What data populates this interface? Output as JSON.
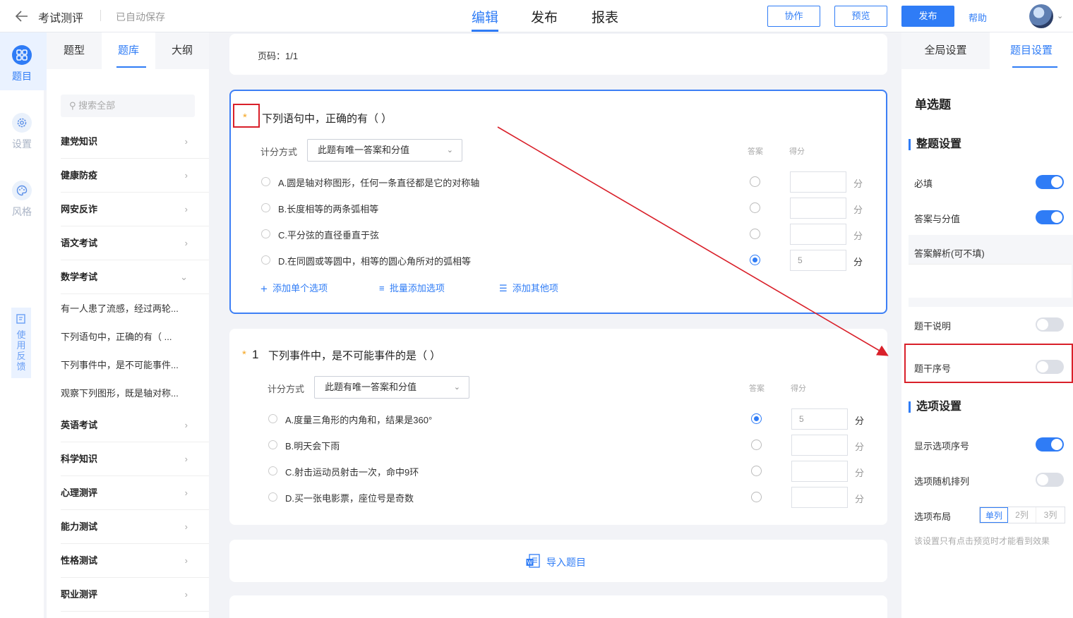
{
  "header": {
    "back_icon": "arrow-left-icon",
    "title": "考试测评",
    "autosave": "已自动保存",
    "tabs": [
      {
        "label": "编辑",
        "active": true
      },
      {
        "label": "发布",
        "active": false
      },
      {
        "label": "报表",
        "active": false
      }
    ],
    "collab_label": "协作",
    "preview_label": "预览",
    "publish_label": "发布",
    "help_label": "帮助"
  },
  "rail": [
    {
      "label": "题目",
      "icon": "grid-icon",
      "active": true
    },
    {
      "label": "设置",
      "icon": "gear-icon",
      "active": false
    },
    {
      "label": "风格",
      "icon": "palette-icon",
      "active": false
    }
  ],
  "feedback_label": "使用反馈",
  "bank": {
    "tabs": [
      "题型",
      "题库",
      "大纲"
    ],
    "active_tab": "题库",
    "search_placeholder": "搜索全部",
    "categories_top": [
      "建党知识",
      "健康防疫",
      "网安反诈",
      "语文考试",
      "数学考试"
    ],
    "expanded_items": [
      "有一人患了流感，经过两轮...",
      "下列语句中，正确的有（  ...",
      "下列事件中，是不可能事件...",
      "观察下列图形，既是轴对称..."
    ],
    "categories_bottom": [
      "英语考试",
      "科学知识",
      "心理测评",
      "能力测试",
      "性格测试",
      "职业测评"
    ]
  },
  "editor": {
    "page_label": "页码：1/1",
    "col_answer": "答案",
    "col_score": "得分",
    "scoring_label": "计分方式",
    "scoring_value": "此题有唯一答案和分值",
    "unit": "分",
    "q1": {
      "star": "*",
      "title": "下列语句中，正确的有（        ）",
      "options": [
        {
          "text": "A.圆是轴对称图形，任何一条直径都是它的对称轴",
          "correct": false,
          "score": ""
        },
        {
          "text": "B.长度相等的两条弧相等",
          "correct": false,
          "score": ""
        },
        {
          "text": "C.平分弦的直径垂直于弦",
          "correct": false,
          "score": ""
        },
        {
          "text": "D.在同圆或等圆中，相等的圆心角所对的弧相等",
          "correct": true,
          "score": "5"
        }
      ]
    },
    "add_single": "添加单个选项",
    "add_batch": "批量添加选项",
    "add_other": "添加其他项",
    "q2": {
      "star": "*",
      "number": "1",
      "title": "下列事件中，是不可能事件的是（        ）",
      "options": [
        {
          "text": "A.度量三角形的内角和，结果是360°",
          "correct": true,
          "score": "5"
        },
        {
          "text": "B.明天会下雨",
          "correct": false,
          "score": ""
        },
        {
          "text": "C.射击运动员射击一次，命中9环",
          "correct": false,
          "score": ""
        },
        {
          "text": "D.买一张电影票，座位号是奇数",
          "correct": false,
          "score": ""
        }
      ]
    },
    "import_label": "导入题目"
  },
  "settings": {
    "tabs": [
      "全局设置",
      "题目设置"
    ],
    "active_tab": "题目设置",
    "qtype": "单选题",
    "section_whole": "整题设置",
    "required": {
      "label": "必填",
      "on": true
    },
    "answer_score": {
      "label": "答案与分值",
      "on": true
    },
    "analysis_label": "答案解析(可不填)",
    "stem_desc": {
      "label": "题干说明",
      "on": false
    },
    "stem_number": {
      "label": "题干序号",
      "on": false
    },
    "section_options": "选项设置",
    "show_opt_number": {
      "label": "显示选项序号",
      "on": true
    },
    "random_order": {
      "label": "选项随机排列",
      "on": false
    },
    "layout_label": "选项布局",
    "layout_options": [
      "单列",
      "2列",
      "3列"
    ],
    "layout_selected": "单列",
    "note": "该设置只有点击预览时才能看到效果"
  },
  "colors": {
    "accent": "#2f7cf6",
    "highlight": "#d9202a",
    "star": "#f5a623"
  }
}
